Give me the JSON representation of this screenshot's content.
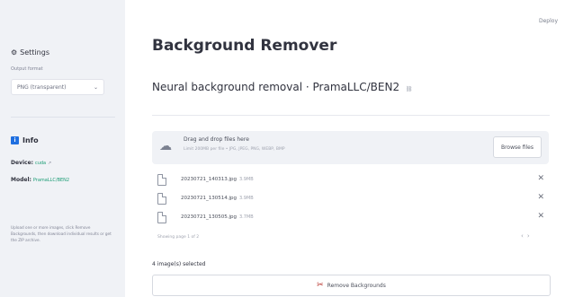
{
  "header": {
    "deploy_label": "Deploy"
  },
  "sidebar": {
    "settings_title": "Settings",
    "output_format_label": "Output format",
    "output_format_value": "PNG (transparent)",
    "info_title": "Info",
    "device_label": "Device:",
    "device_value": "cuda",
    "model_label": "Model:",
    "model_value": "PramaLLC/BEN2",
    "note": "Upload one or more images, click Remove Backgrounds, then download individual results or get the ZIP archive."
  },
  "main": {
    "title": "Background Remover",
    "subtitle": "Neural background removal · PramaLLC/BEN2",
    "uploader": {
      "title": "Drag and drop files here",
      "subtitle": "Limit 200MB per file • JPG, JPEG, PNG, WEBP, BMP",
      "browse_label": "Browse files"
    },
    "files": [
      {
        "name": "20230721_140313.jpg",
        "size": "3.9MB"
      },
      {
        "name": "20230721_130514.jpg",
        "size": "3.9MB"
      },
      {
        "name": "20230721_130505.jpg",
        "size": "3.7MB"
      }
    ],
    "paging_text": "Showing page 1 of 2",
    "selected_text": "4 image(s) selected",
    "remove_button_label": "Remove Backgrounds"
  },
  "icons": {
    "settings": "gear-icon",
    "info": "info-icon",
    "upload": "cloud-upload-icon",
    "file": "file-icon",
    "close": "close-icon",
    "remove": "scissors-icon"
  }
}
